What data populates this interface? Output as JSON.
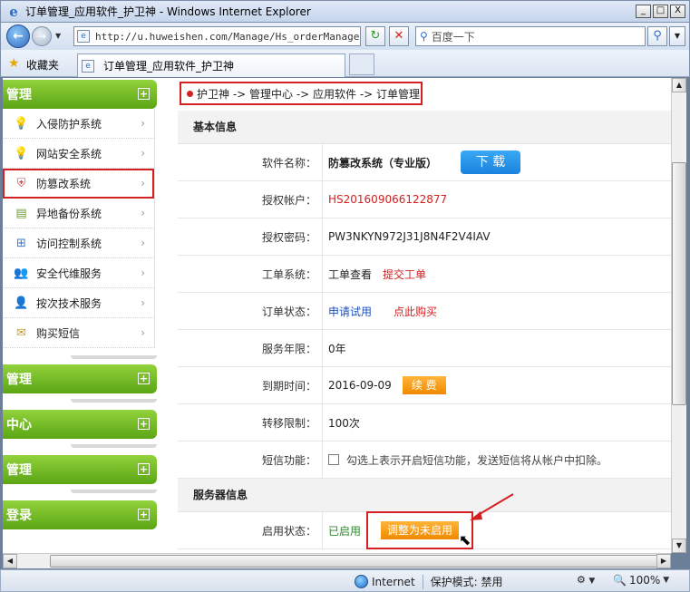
{
  "window": {
    "title": "订单管理_应用软件_护卫神 - Windows Internet Explorer",
    "minimize": "_",
    "maximize": "□",
    "close": "X"
  },
  "nav": {
    "address": "http://u.huweishen.com/Manage/Hs_orderManage.a",
    "search_placeholder": "百度一下"
  },
  "favorites": {
    "label": "收藏夹",
    "tab_title": "订单管理_应用软件_护卫神"
  },
  "sidebar": {
    "groups": [
      {
        "title": "管理"
      },
      {
        "title": "管理"
      },
      {
        "title": "中心"
      },
      {
        "title": "管理"
      },
      {
        "title": "登录"
      }
    ],
    "items": [
      {
        "label": "入侵防护系统",
        "icon": "lightbulb-icon"
      },
      {
        "label": "网站安全系统",
        "icon": "lightbulb-icon"
      },
      {
        "label": "防篡改系统",
        "icon": "shield-icon"
      },
      {
        "label": "异地备份系统",
        "icon": "database-icon"
      },
      {
        "label": "访问控制系统",
        "icon": "access-icon"
      },
      {
        "label": "安全代维服务",
        "icon": "users-icon"
      },
      {
        "label": "按次技术服务",
        "icon": "user-icon"
      },
      {
        "label": "购买短信",
        "icon": "sms-icon"
      }
    ]
  },
  "breadcrumb": {
    "text": "护卫神 -> 管理中心 -> 应用软件 -> 订单管理"
  },
  "basic": {
    "title": "基本信息",
    "software_label": "软件名称：",
    "software_value": "防篡改系统（专业版）",
    "download_label": "下 载",
    "account_label": "授权帐户：",
    "account_value": "HS201609066122877",
    "password_label": "授权密码：",
    "password_value": "PW3NKYN972J31J8N4F2V4IAV",
    "ticket_label": "工单系统：",
    "ticket_view": "工单查看",
    "ticket_submit": "提交工单",
    "order_label": "订单状态：",
    "order_trial": "申请试用",
    "order_buy": "点此购买",
    "years_label": "服务年限：",
    "years_value": "0年",
    "expire_label": "到期时间：",
    "expire_value": "2016-09-09",
    "renew_label": "续 费",
    "transfer_label": "转移限制：",
    "transfer_value": "100次",
    "sms_label": "短信功能：",
    "sms_text": "勾选上表示开启短信功能，发送短信将从帐户中扣除。"
  },
  "server": {
    "title": "服务器信息",
    "enable_label": "启用状态：",
    "enable_value": "已启用",
    "adjust_label": "调整为未启用"
  },
  "status": {
    "zone": "Internet",
    "protected": "保护模式: 禁用",
    "zoom": "100%"
  },
  "colors": {
    "accent_green": "#5ba515",
    "highlight_red": "#d32020",
    "button_orange": "#f08a00",
    "button_blue": "#1a82de"
  }
}
